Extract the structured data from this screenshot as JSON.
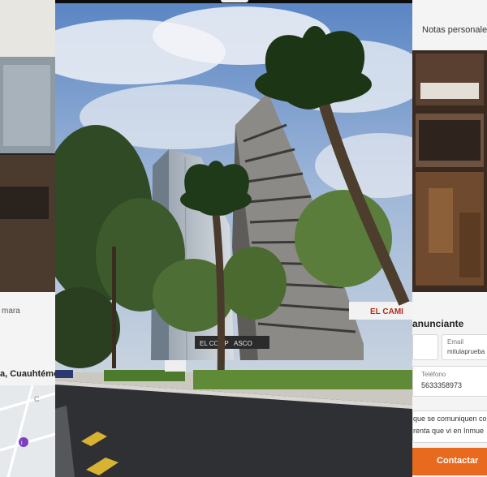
{
  "left_panel": {
    "text_partial_1": "mara",
    "text_partial_2": "a, Cuauhtémo",
    "map_label": "C"
  },
  "right_panel": {
    "header_title": "Notas personales",
    "section_title": "anunciante",
    "email_label": "Email",
    "email_value": "mitulaprueba",
    "phone_label": "Teléfono",
    "phone_value": "5633358973",
    "message_line_1": "que se comuniquen co",
    "message_line_2": "renta que vi en Inmue",
    "contact_button": "Contactar",
    "accent_color": "#e86a1e"
  },
  "photo": {
    "sign_1": "EL CAMI",
    "sign_2": "EL COMP",
    "sign_3": "ASCO"
  }
}
